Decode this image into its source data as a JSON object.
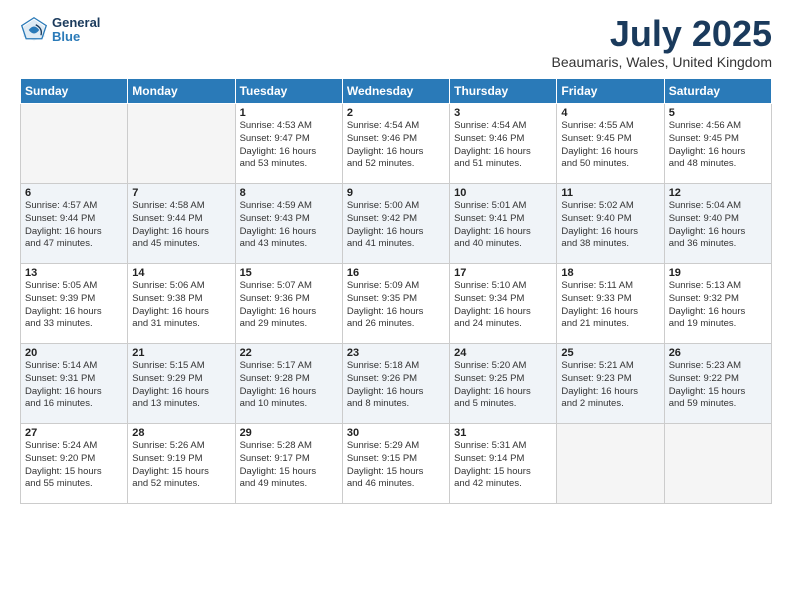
{
  "header": {
    "logo_general": "General",
    "logo_blue": "Blue",
    "title": "July 2025",
    "location": "Beaumaris, Wales, United Kingdom"
  },
  "days_of_week": [
    "Sunday",
    "Monday",
    "Tuesday",
    "Wednesday",
    "Thursday",
    "Friday",
    "Saturday"
  ],
  "weeks": [
    [
      {
        "day": "",
        "detail": ""
      },
      {
        "day": "",
        "detail": ""
      },
      {
        "day": "1",
        "detail": "Sunrise: 4:53 AM\nSunset: 9:47 PM\nDaylight: 16 hours\nand 53 minutes."
      },
      {
        "day": "2",
        "detail": "Sunrise: 4:54 AM\nSunset: 9:46 PM\nDaylight: 16 hours\nand 52 minutes."
      },
      {
        "day": "3",
        "detail": "Sunrise: 4:54 AM\nSunset: 9:46 PM\nDaylight: 16 hours\nand 51 minutes."
      },
      {
        "day": "4",
        "detail": "Sunrise: 4:55 AM\nSunset: 9:45 PM\nDaylight: 16 hours\nand 50 minutes."
      },
      {
        "day": "5",
        "detail": "Sunrise: 4:56 AM\nSunset: 9:45 PM\nDaylight: 16 hours\nand 48 minutes."
      }
    ],
    [
      {
        "day": "6",
        "detail": "Sunrise: 4:57 AM\nSunset: 9:44 PM\nDaylight: 16 hours\nand 47 minutes."
      },
      {
        "day": "7",
        "detail": "Sunrise: 4:58 AM\nSunset: 9:44 PM\nDaylight: 16 hours\nand 45 minutes."
      },
      {
        "day": "8",
        "detail": "Sunrise: 4:59 AM\nSunset: 9:43 PM\nDaylight: 16 hours\nand 43 minutes."
      },
      {
        "day": "9",
        "detail": "Sunrise: 5:00 AM\nSunset: 9:42 PM\nDaylight: 16 hours\nand 41 minutes."
      },
      {
        "day": "10",
        "detail": "Sunrise: 5:01 AM\nSunset: 9:41 PM\nDaylight: 16 hours\nand 40 minutes."
      },
      {
        "day": "11",
        "detail": "Sunrise: 5:02 AM\nSunset: 9:40 PM\nDaylight: 16 hours\nand 38 minutes."
      },
      {
        "day": "12",
        "detail": "Sunrise: 5:04 AM\nSunset: 9:40 PM\nDaylight: 16 hours\nand 36 minutes."
      }
    ],
    [
      {
        "day": "13",
        "detail": "Sunrise: 5:05 AM\nSunset: 9:39 PM\nDaylight: 16 hours\nand 33 minutes."
      },
      {
        "day": "14",
        "detail": "Sunrise: 5:06 AM\nSunset: 9:38 PM\nDaylight: 16 hours\nand 31 minutes."
      },
      {
        "day": "15",
        "detail": "Sunrise: 5:07 AM\nSunset: 9:36 PM\nDaylight: 16 hours\nand 29 minutes."
      },
      {
        "day": "16",
        "detail": "Sunrise: 5:09 AM\nSunset: 9:35 PM\nDaylight: 16 hours\nand 26 minutes."
      },
      {
        "day": "17",
        "detail": "Sunrise: 5:10 AM\nSunset: 9:34 PM\nDaylight: 16 hours\nand 24 minutes."
      },
      {
        "day": "18",
        "detail": "Sunrise: 5:11 AM\nSunset: 9:33 PM\nDaylight: 16 hours\nand 21 minutes."
      },
      {
        "day": "19",
        "detail": "Sunrise: 5:13 AM\nSunset: 9:32 PM\nDaylight: 16 hours\nand 19 minutes."
      }
    ],
    [
      {
        "day": "20",
        "detail": "Sunrise: 5:14 AM\nSunset: 9:31 PM\nDaylight: 16 hours\nand 16 minutes."
      },
      {
        "day": "21",
        "detail": "Sunrise: 5:15 AM\nSunset: 9:29 PM\nDaylight: 16 hours\nand 13 minutes."
      },
      {
        "day": "22",
        "detail": "Sunrise: 5:17 AM\nSunset: 9:28 PM\nDaylight: 16 hours\nand 10 minutes."
      },
      {
        "day": "23",
        "detail": "Sunrise: 5:18 AM\nSunset: 9:26 PM\nDaylight: 16 hours\nand 8 minutes."
      },
      {
        "day": "24",
        "detail": "Sunrise: 5:20 AM\nSunset: 9:25 PM\nDaylight: 16 hours\nand 5 minutes."
      },
      {
        "day": "25",
        "detail": "Sunrise: 5:21 AM\nSunset: 9:23 PM\nDaylight: 16 hours\nand 2 minutes."
      },
      {
        "day": "26",
        "detail": "Sunrise: 5:23 AM\nSunset: 9:22 PM\nDaylight: 15 hours\nand 59 minutes."
      }
    ],
    [
      {
        "day": "27",
        "detail": "Sunrise: 5:24 AM\nSunset: 9:20 PM\nDaylight: 15 hours\nand 55 minutes."
      },
      {
        "day": "28",
        "detail": "Sunrise: 5:26 AM\nSunset: 9:19 PM\nDaylight: 15 hours\nand 52 minutes."
      },
      {
        "day": "29",
        "detail": "Sunrise: 5:28 AM\nSunset: 9:17 PM\nDaylight: 15 hours\nand 49 minutes."
      },
      {
        "day": "30",
        "detail": "Sunrise: 5:29 AM\nSunset: 9:15 PM\nDaylight: 15 hours\nand 46 minutes."
      },
      {
        "day": "31",
        "detail": "Sunrise: 5:31 AM\nSunset: 9:14 PM\nDaylight: 15 hours\nand 42 minutes."
      },
      {
        "day": "",
        "detail": ""
      },
      {
        "day": "",
        "detail": ""
      }
    ]
  ]
}
